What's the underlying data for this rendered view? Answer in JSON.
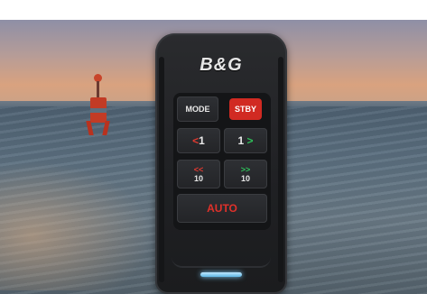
{
  "remote": {
    "brand": "B&G",
    "buttons": {
      "mode": "MODE",
      "standby": "STBY",
      "port_1": {
        "arrow": "<",
        "value": "1"
      },
      "starboard_1": {
        "value": "1",
        "arrow": ">"
      },
      "port_10": {
        "arrow": "<<",
        "value": "10"
      },
      "starboard_10": {
        "arrow": ">>",
        "value": "10"
      },
      "auto": "AUTO"
    }
  },
  "colors": {
    "standby_button": "#d12a22",
    "port_arrow": "#e23a30",
    "starboard_arrow": "#2fbf5a",
    "auto_text": "#e0312a",
    "status_led": "#5fb7e6"
  }
}
